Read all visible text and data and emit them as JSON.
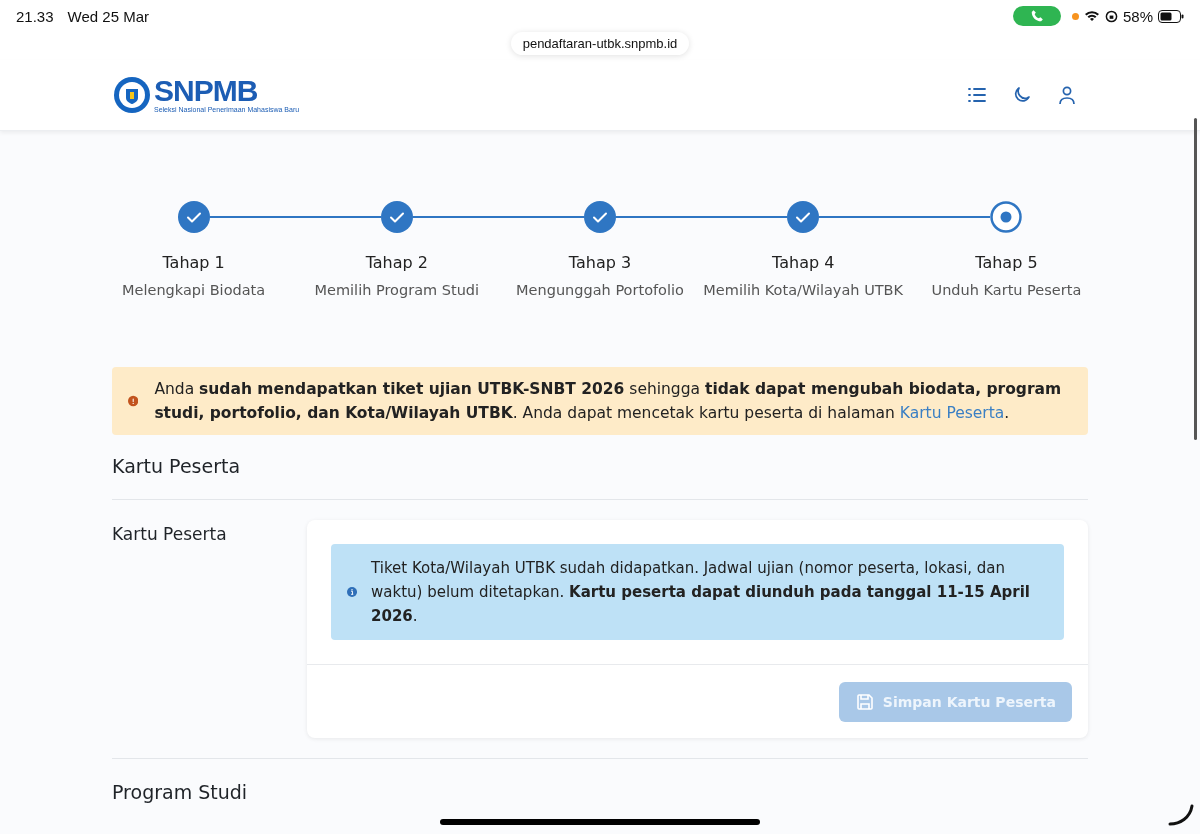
{
  "status_bar": {
    "time": "21.33",
    "date": "Wed 25 Mar",
    "battery": "58%"
  },
  "address_bar": {
    "url": "pendaftaran-utbk.snpmb.id"
  },
  "header": {
    "logo_text": "SNPMB",
    "logo_tagline": "Seleksi Nasional Penerimaan Mahasiswa Baru"
  },
  "steps": [
    {
      "title": "Tahap 1",
      "subtitle": "Melengkapi Biodata",
      "kind": "done"
    },
    {
      "title": "Tahap 2",
      "subtitle": "Memilih Program Studi",
      "kind": "done"
    },
    {
      "title": "Tahap 3",
      "subtitle": "Mengunggah Portofolio",
      "kind": "done"
    },
    {
      "title": "Tahap 4",
      "subtitle": "Memilih Kota/Wilayah UTBK",
      "kind": "done"
    },
    {
      "title": "Tahap 5",
      "subtitle": "Unduh Kartu Peserta",
      "kind": "current"
    }
  ],
  "warning": {
    "text": "Anda **sudah mendapatkan tiket ujian UTBK-SNBT 2026** sehingga **tidak dapat mengubah biodata, program studi, portofolio, dan Kota/Wilayah UTBK**. Anda dapat mencetak kartu peserta di halaman",
    "link": "Kartu Peserta",
    "end": "."
  },
  "section_title": "Kartu Peserta",
  "card": {
    "label": "Kartu Peserta",
    "info": "Tiket Kota/Wilayah UTBK sudah didapatkan. Jadwal ujian (nomor peserta, lokasi, dan waktu) belum ditetapkan. **Kartu peserta dapat diunduh pada tanggal 11-15 April 2026**.",
    "button": {
      "label": "Simpan Kartu Peserta",
      "disabled": true
    }
  },
  "next_section_title": "Program Studi"
}
